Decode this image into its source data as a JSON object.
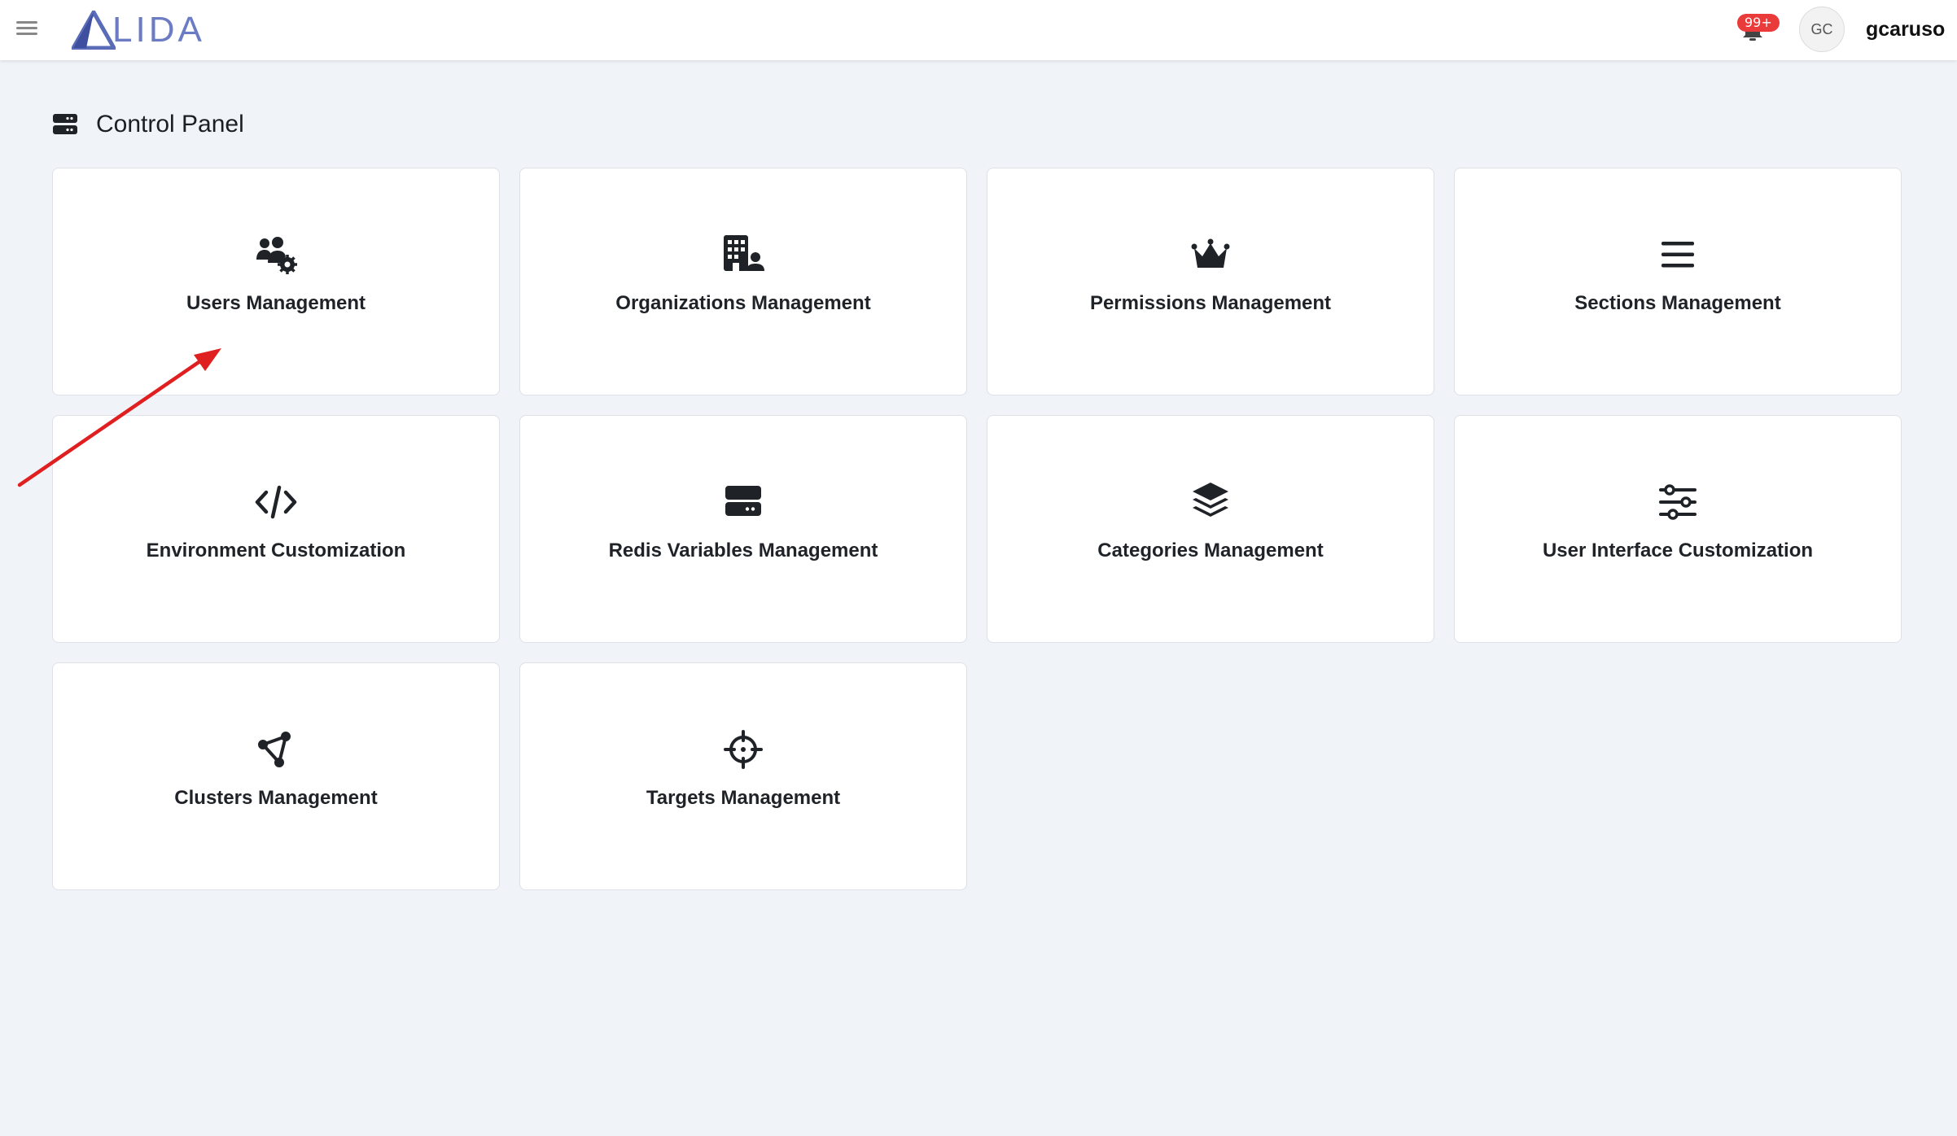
{
  "header": {
    "logo_text": "LIDA",
    "notification_count": "99+",
    "avatar_initials": "GC",
    "username": "gcaruso"
  },
  "page": {
    "title": "Control Panel"
  },
  "cards": [
    {
      "label": "Users Management",
      "icon": "users-cog-icon"
    },
    {
      "label": "Organizations Management",
      "icon": "building-user-icon"
    },
    {
      "label": "Permissions Management",
      "icon": "crown-icon"
    },
    {
      "label": "Sections Management",
      "icon": "bars-icon"
    },
    {
      "label": "Environment Customization",
      "icon": "code-icon"
    },
    {
      "label": "Redis Variables Management",
      "icon": "server-icon"
    },
    {
      "label": "Categories Management",
      "icon": "layers-icon"
    },
    {
      "label": "User Interface Customization",
      "icon": "sliders-icon"
    },
    {
      "label": "Clusters Management",
      "icon": "nodes-icon"
    },
    {
      "label": "Targets Management",
      "icon": "crosshair-icon"
    }
  ],
  "colors": {
    "background": "#f0f3f8",
    "logo": "#6b7cc4",
    "badge": "#ea3a3a",
    "annotation_arrow": "#e02020"
  }
}
